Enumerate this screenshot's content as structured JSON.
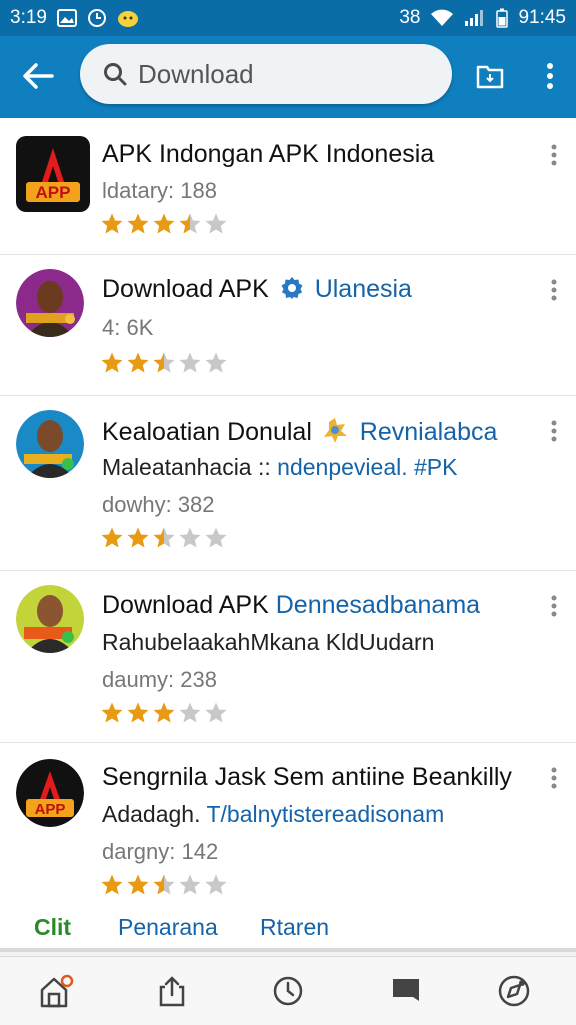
{
  "status_bar": {
    "time": "3:19",
    "network": "38",
    "clock": "91:45"
  },
  "search": {
    "placeholder": "Download"
  },
  "apps": [
    {
      "title": "APK Indongan APK Indonesia",
      "title_accent": "",
      "subtitle": "",
      "subtitle_accent": "",
      "meta": "ldatary: 188",
      "rating": 3.5
    },
    {
      "title": "Download APK",
      "title_accent": "Ulanesia",
      "subtitle": "",
      "subtitle_accent": "",
      "meta": "4: 6K",
      "rating": 2.5
    },
    {
      "title": "Kealoatian Donulal",
      "title_accent": "Revnialabca",
      "subtitle": "Maleatanhacia ::",
      "subtitle_accent": "ndenpevieal. #PK",
      "meta": "dowhy: 382",
      "rating": 2.5
    },
    {
      "title": "Download APK",
      "title_accent": "Dennesadbanama",
      "subtitle": "RahubelaakahMkana KldUudarn",
      "subtitle_accent": "",
      "meta": "daumy: 238",
      "rating": 3
    },
    {
      "title": "Sengrnila Jask Sem antiine Beankilly",
      "title_accent": "",
      "subtitle": "Adadagh.",
      "subtitle_accent": "T/balnytistereadisonam",
      "meta": "dargny: 142",
      "rating": 2.5
    }
  ],
  "tabs": [
    "Clit",
    "Penarana",
    "Rtaren"
  ],
  "colors": {
    "appbar": "#0f7fbf",
    "statusbar": "#0b6da8",
    "accent_text": "#1563a8",
    "star_filled": "#e89a12",
    "star_empty": "#c8c8c8",
    "tab_first": "#2a8a2a"
  },
  "icons": {
    "back": "arrow-left-icon",
    "search": "search-icon",
    "folder": "folder-icon",
    "more": "more-vert-icon",
    "nav": [
      "home-icon",
      "share-icon",
      "clock-icon",
      "inbox-icon",
      "compass-icon"
    ]
  }
}
